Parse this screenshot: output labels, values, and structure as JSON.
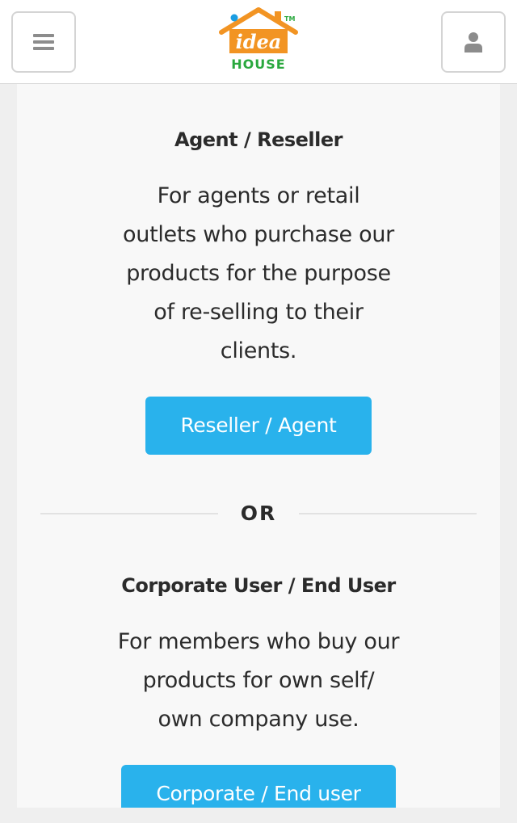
{
  "header": {
    "menu_icon": "hamburger-menu-icon",
    "user_icon": "user-icon",
    "logo": {
      "word": "idea",
      "sub": "HOUSE",
      "tm": "TM",
      "colors": {
        "orange": "#f29423",
        "green": "#2aa83e",
        "blue": "#1b9de2"
      }
    }
  },
  "reseller": {
    "title": "Agent / Reseller",
    "description_lines": [
      "For agents or retail",
      "outlets who purchase our",
      "products for the purpose",
      "of re-selling to their",
      "clients."
    ],
    "button_label": "Reseller / Agent"
  },
  "separator": {
    "label": "OR"
  },
  "corporate": {
    "title": "Corporate User / End User",
    "description_lines": [
      "For members who buy our",
      "products for own self/",
      "own company use."
    ],
    "button_label": "Corporate / End user"
  },
  "colors": {
    "accent": "#29b2ec",
    "text": "#2b2b2b",
    "panel": "#f8f8f8",
    "page": "#efefef"
  }
}
